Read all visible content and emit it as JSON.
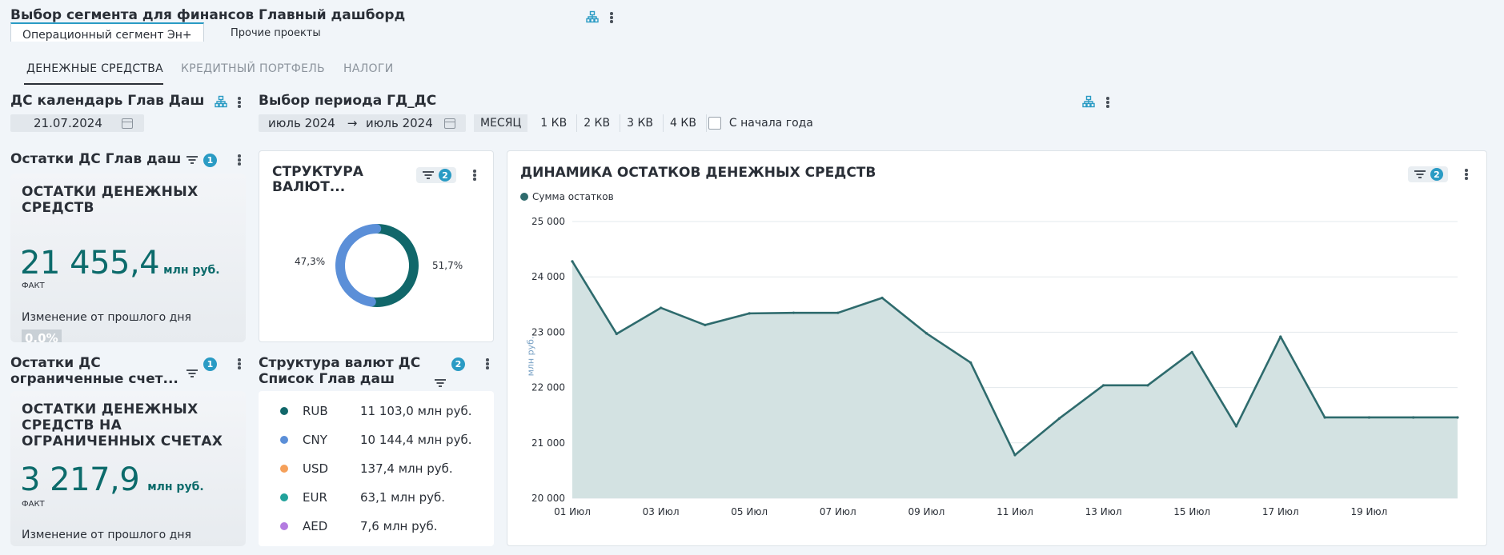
{
  "header": {
    "title": "Выбор сегмента для финансов Главный дашборд",
    "segment_tabs": [
      "Операционный сегмент Эн+",
      "Прочие проекты"
    ]
  },
  "nav_tabs": [
    "ДЕНЕЖНЫЕ СРЕДСТВА",
    "КРЕДИТНЫЙ ПОРТФЕЛЬ",
    "НАЛОГИ"
  ],
  "calendar": {
    "title": "ДС календарь Глав Даш",
    "date": "21.07.2024"
  },
  "period": {
    "title": "Выбор периода ГД_ДС",
    "from": "июль 2024",
    "arrow": "→",
    "to": "июль 2024",
    "options": [
      "МЕСЯЦ",
      "1 КВ",
      "2 КВ",
      "3 КВ",
      "4 КВ"
    ],
    "selected": "МЕСЯЦ",
    "ytd_label": "С начала года",
    "ytd_checked": false
  },
  "widget1": {
    "title": "Остатки ДС Глав даш",
    "filter_count": "1",
    "kpi_title": "ОСТАТКИ ДЕНЕЖНЫХ СРЕДСТВ",
    "value": "21 455,4",
    "unit": "млн руб.",
    "fact_label": "ФАКТ",
    "change_label": "Изменение от прошлого дня",
    "change_value": "0,0%"
  },
  "widget2": {
    "title": "Остатки ДС ограниченные счет...",
    "filter_count": "1",
    "kpi_title": "ОСТАТКИ ДЕНЕЖНЫХ СРЕДСТВ НА ОГРАНИЧЕННЫХ СЧЕТАХ",
    "value": "3 217,9",
    "unit": "млн руб.",
    "fact_label": "ФАКТ",
    "change_label": "Изменение от прошлого дня"
  },
  "donut": {
    "title": "СТРУКТУРА ВАЛЮТ...",
    "filter_count": "2",
    "left_pct": "47,3%",
    "right_pct": "51,7%",
    "segments": [
      {
        "share": 51.7,
        "color": "#11676a"
      },
      {
        "share": 47.3,
        "color": "#5b8fd8"
      }
    ]
  },
  "currency_list": {
    "title": "Структура валют ДС Список Глав даш",
    "filter_count": "2",
    "items": [
      {
        "code": "RUB",
        "value": "11 103,0 млн руб.",
        "color": "#11676a"
      },
      {
        "code": "CNY",
        "value": "10 144,4 млн руб.",
        "color": "#5b8fd8"
      },
      {
        "code": "USD",
        "value": "137,4 млн руб.",
        "color": "#f5a05a"
      },
      {
        "code": "EUR",
        "value": "63,1 млн руб.",
        "color": "#21a29b"
      },
      {
        "code": "AED",
        "value": "7,6 млн руб.",
        "color": "#b37be0"
      }
    ]
  },
  "dynamics": {
    "title": "ДИНАМИКА ОСТАТКОВ ДЕНЕЖНЫХ СРЕДСТВ",
    "filter_count": "2",
    "legend": "Сумма остатков",
    "ylabel": "млн руб.",
    "line_color": "#2e6b6d",
    "fill_color": "#d3e2e2"
  },
  "chart_data": {
    "type": "area",
    "title": "ДИНАМИКА ОСТАТКОВ ДЕНЕЖНЫХ СРЕДСТВ",
    "xlabel": "",
    "ylabel": "млн руб.",
    "ylim": [
      20000,
      25000
    ],
    "yticks": [
      20000,
      21000,
      22000,
      23000,
      24000,
      25000
    ],
    "ytick_labels": [
      "20 000",
      "21 000",
      "22 000",
      "23 000",
      "24 000",
      "25 000"
    ],
    "x_tick_labels": [
      "01 Июл",
      "03 Июл",
      "05 Июл",
      "07 Июл",
      "09 Июл",
      "11 Июл",
      "13 Июл",
      "15 Июл",
      "17 Июл",
      "19 Июл"
    ],
    "x_tick_days": [
      1,
      3,
      5,
      7,
      9,
      11,
      13,
      15,
      17,
      19
    ],
    "x_days": [
      1,
      2,
      3,
      4,
      5,
      6,
      7,
      8,
      9,
      10,
      11,
      12,
      13,
      14,
      15,
      16,
      17,
      18,
      19,
      20,
      21
    ],
    "x_max_day": 21,
    "grid": true,
    "legend_position": "top-left",
    "series": [
      {
        "name": "Сумма остатков",
        "values": [
          24280,
          22970,
          23440,
          23130,
          23340,
          23350,
          23350,
          23620,
          22980,
          22450,
          20780,
          21440,
          22040,
          22040,
          22640,
          21300,
          22920,
          21460,
          21460,
          21460,
          21460
        ]
      }
    ]
  }
}
